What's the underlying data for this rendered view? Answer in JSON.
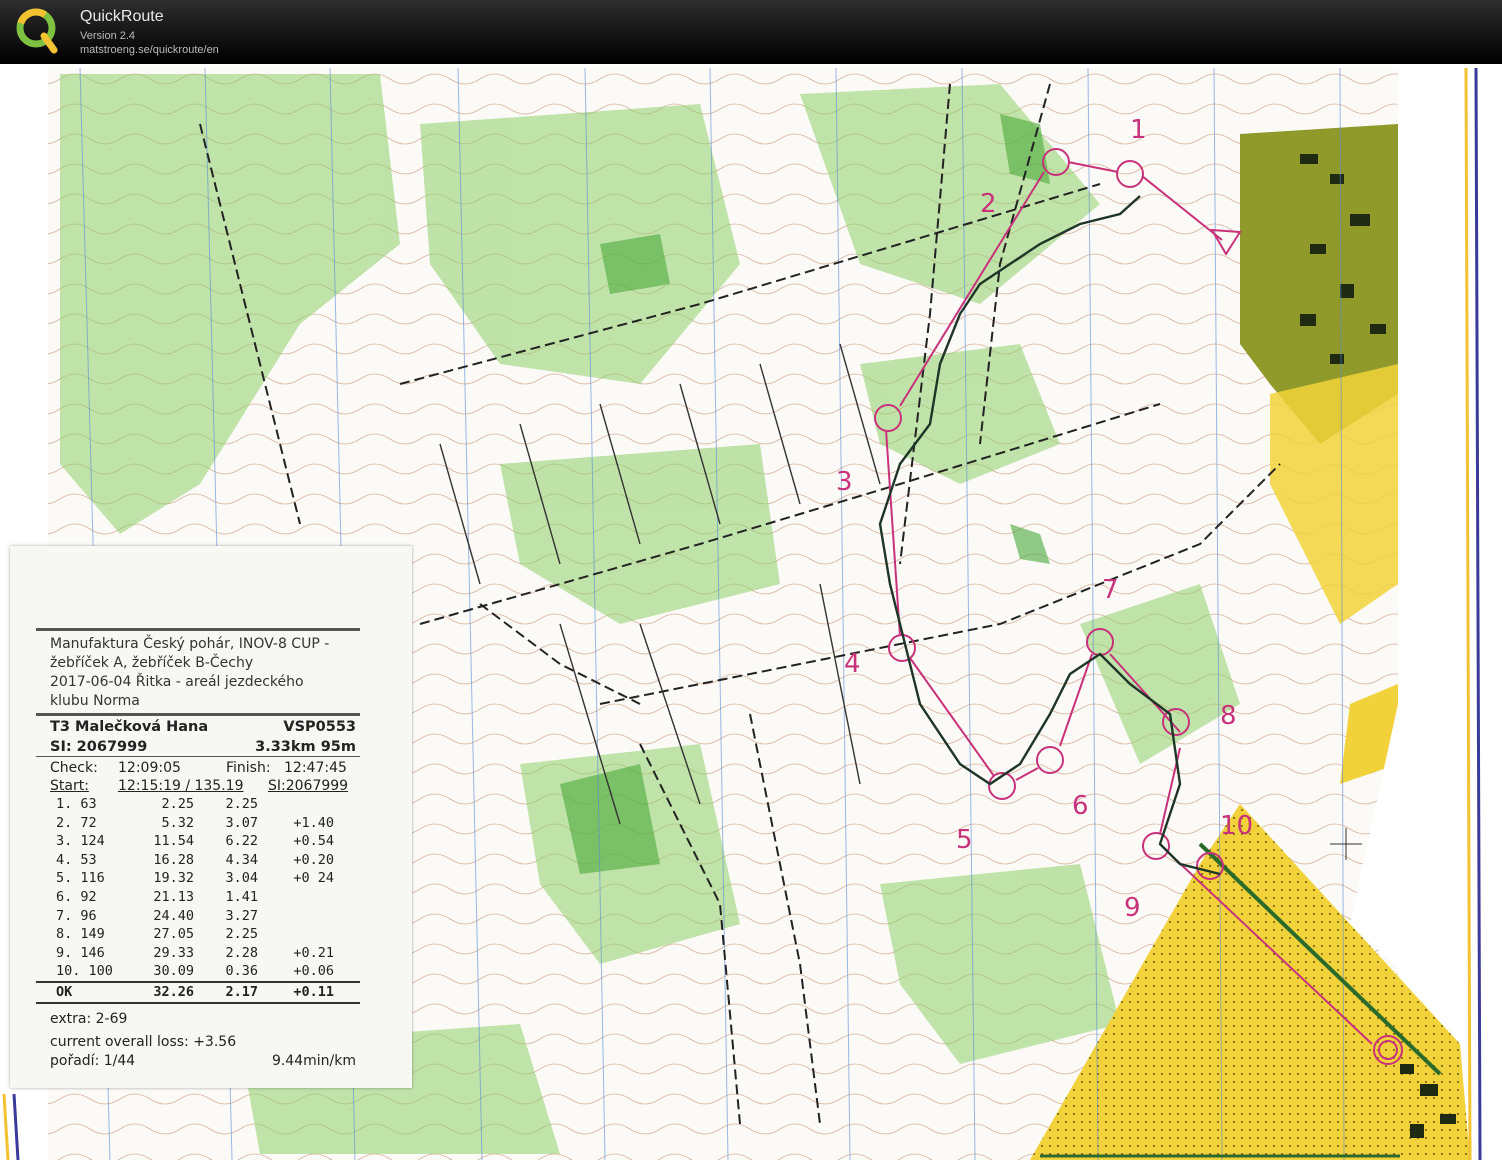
{
  "titlebar": {
    "app_name": "QuickRoute",
    "version": "Version 2.4",
    "url": "matstroeng.se/quickroute/en"
  },
  "colors": {
    "course": "#c8327a",
    "route": "#2a3a2a",
    "forest": "#8fd06a",
    "yellow": "#f2d23a"
  },
  "map": {
    "control_labels": [
      "1",
      "2",
      "3",
      "4",
      "5",
      "6",
      "7",
      "8",
      "9",
      "10"
    ]
  },
  "splits": {
    "event_lines": [
      "Manufaktura Český pohár, INOV-8 CUP -",
      "žebříček A, žebříček B-Čechy",
      "2017-06-04 Řitka - areál jezdeckého",
      "klubu Norma"
    ],
    "runner_name": "T3 Malečková Hana",
    "club": "VSP0553",
    "si_label": "SI: 2067999",
    "course_info": "3.33km 95m",
    "check_label": "Check:",
    "check_time": "12:09:05",
    "finish_label": "Finish:",
    "finish_time": "12:47:45",
    "start_label": "Start:",
    "start_time": "12:15:19 / 135.19",
    "start_si": "SI:2067999",
    "rows": [
      {
        "id": "1. 63",
        "total": "2.25",
        "split": "2.25",
        "loss": ""
      },
      {
        "id": "2. 72",
        "total": "5.32",
        "split": "3.07",
        "loss": "+1.40"
      },
      {
        "id": "3. 124",
        "total": "11.54",
        "split": "6.22",
        "loss": "+0.54"
      },
      {
        "id": "4. 53",
        "total": "16.28",
        "split": "4.34",
        "loss": "+0.20"
      },
      {
        "id": "5. 116",
        "total": "19.32",
        "split": "3.04",
        "loss": "+0 24"
      },
      {
        "id": "6. 92",
        "total": "21.13",
        "split": "1.41",
        "loss": ""
      },
      {
        "id": "7. 96",
        "total": "24.40",
        "split": "3.27",
        "loss": ""
      },
      {
        "id": "8. 149",
        "total": "27.05",
        "split": "2.25",
        "loss": ""
      },
      {
        "id": "9. 146",
        "total": "29.33",
        "split": "2.28",
        "loss": "+0.21"
      },
      {
        "id": "10. 100",
        "total": "30.09",
        "split": "0.36",
        "loss": "+0.06"
      }
    ],
    "ok_row": {
      "id": "OK",
      "total": "32.26",
      "split": "2.17",
      "loss": "+0.11"
    },
    "extra": "extra: 2-69",
    "overall_loss": "current overall loss: +3.56",
    "place": "pořadí: 1/44",
    "pace": "9.44min/km"
  }
}
